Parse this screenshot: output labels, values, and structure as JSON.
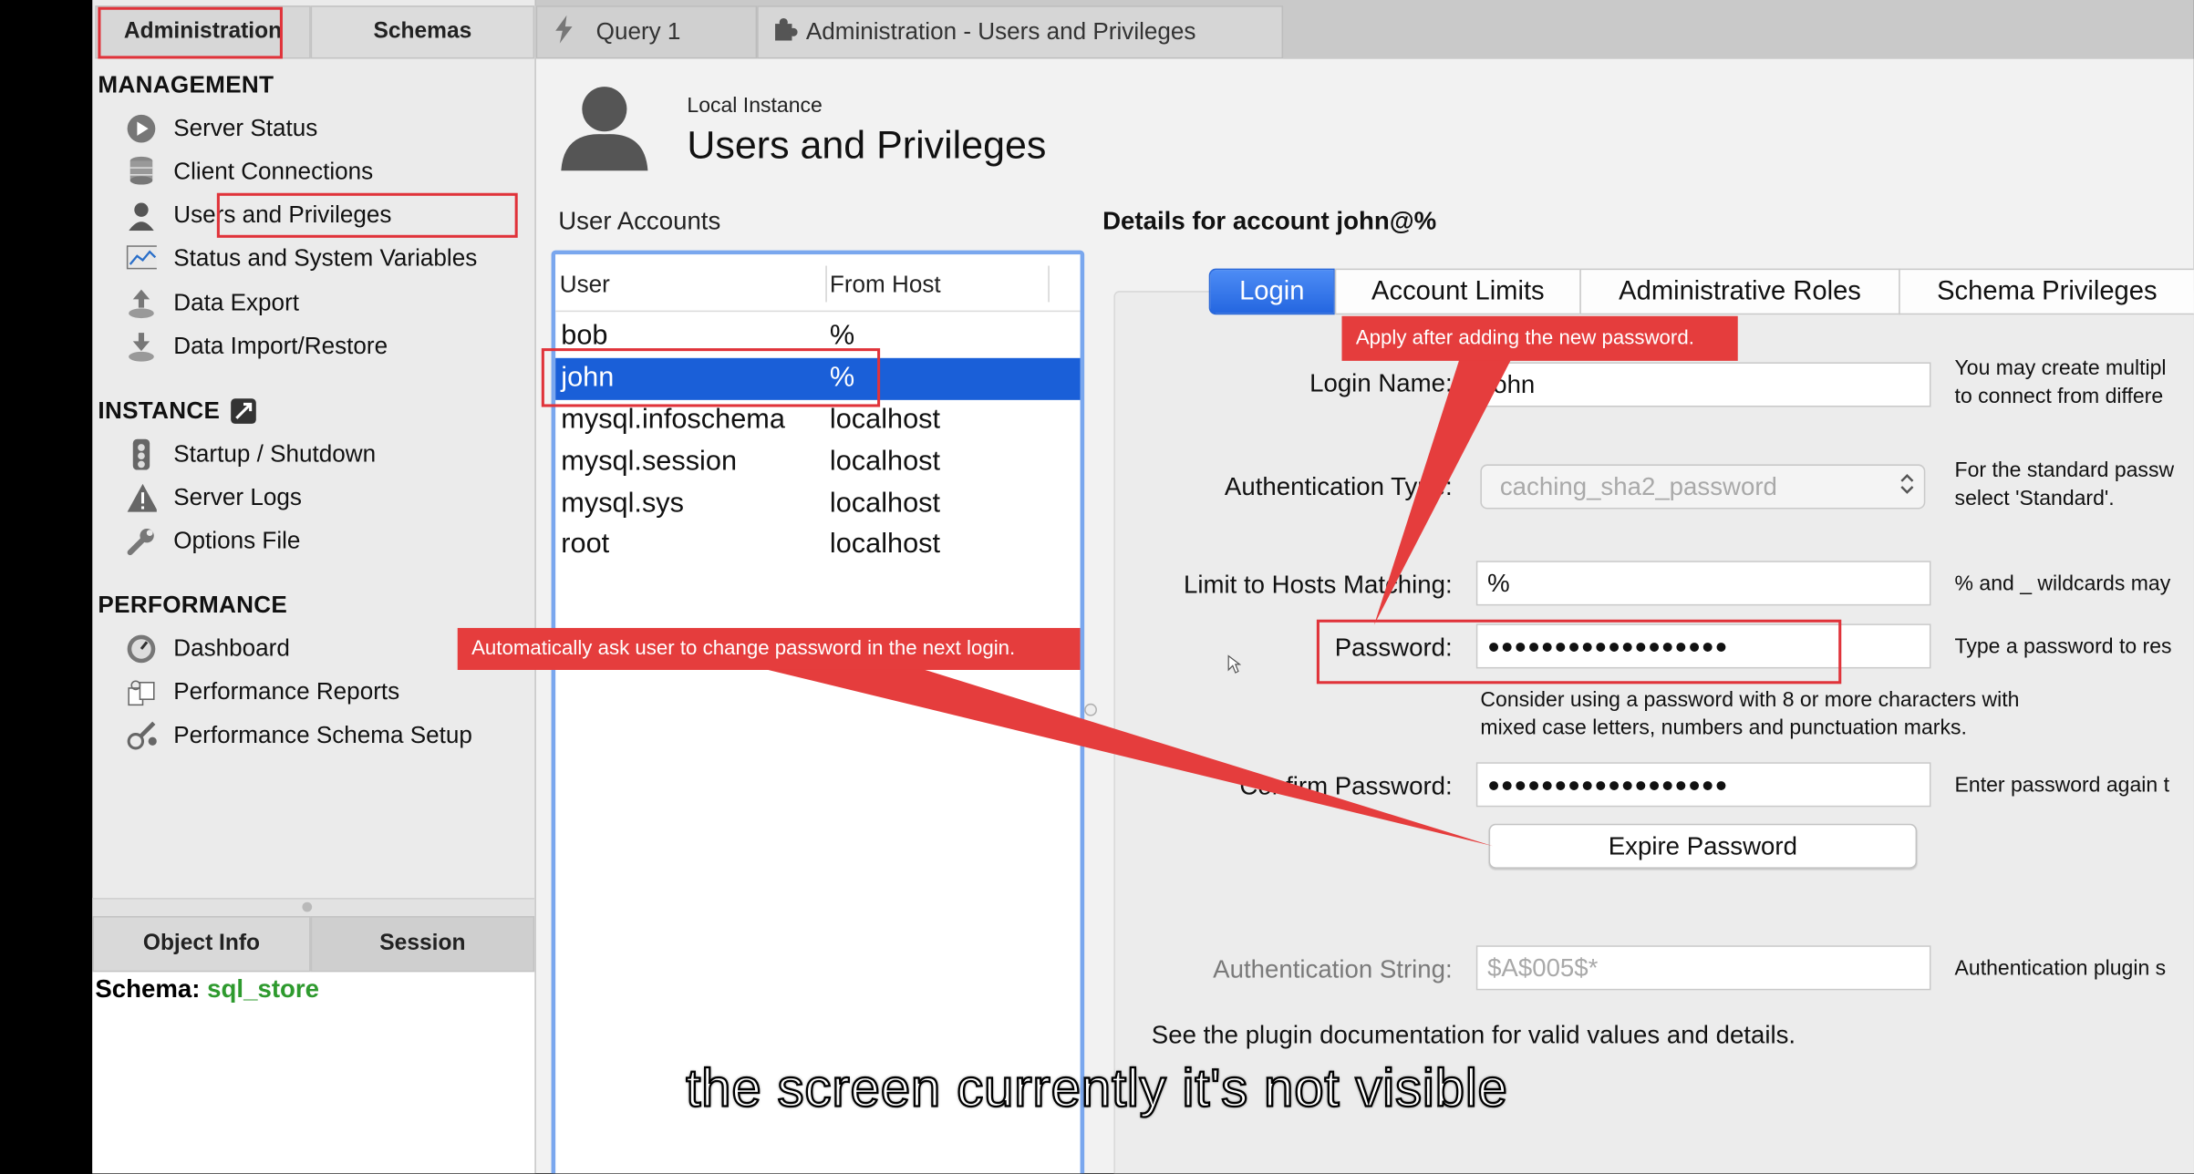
{
  "sidebar": {
    "tabs": [
      "Administration",
      "Schemas"
    ],
    "sections": {
      "management": "MANAGEMENT",
      "instance": "INSTANCE",
      "performance": "PERFORMANCE"
    },
    "management_items": [
      "Server Status",
      "Client Connections",
      "Users and Privileges",
      "Status and System Variables",
      "Data Export",
      "Data Import/Restore"
    ],
    "instance_items": [
      "Startup / Shutdown",
      "Server Logs",
      "Options File"
    ],
    "performance_items": [
      "Dashboard",
      "Performance Reports",
      "Performance Schema Setup"
    ],
    "bottom_tabs": [
      "Object Info",
      "Session"
    ],
    "schema_label": "Schema:",
    "schema_value": "sql_store"
  },
  "editor_tabs": [
    "Query 1",
    "Administration - Users and Privileges"
  ],
  "page": {
    "subtitle": "Local Instance",
    "title": "Users and Privileges"
  },
  "accounts": {
    "label": "User Accounts",
    "columns": [
      "User",
      "From Host"
    ],
    "rows": [
      {
        "user": "bob",
        "host": "%"
      },
      {
        "user": "john",
        "host": "%"
      },
      {
        "user": "mysql.infoschema",
        "host": "localhost"
      },
      {
        "user": "mysql.session",
        "host": "localhost"
      },
      {
        "user": "mysql.sys",
        "host": "localhost"
      },
      {
        "user": "root",
        "host": "localhost"
      }
    ],
    "selected_index": 1
  },
  "details": {
    "heading": "Details for account john@%",
    "tabs": [
      "Login",
      "Account Limits",
      "Administrative Roles",
      "Schema Privileges"
    ],
    "login_name_label": "Login Name:",
    "login_name_value": "john",
    "auth_type_label": "Authentication Type:",
    "auth_type_value": "caching_sha2_password",
    "hosts_label": "Limit to Hosts Matching:",
    "hosts_value": "%",
    "password_label": "Password:",
    "password_value": "●●●●●●●●●●●●●●●●●●",
    "password_hint_1": "Consider using a password with 8 or more characters with",
    "password_hint_2": "mixed case letters, numbers and punctuation marks.",
    "confirm_label": "Confirm Password:",
    "confirm_value": "●●●●●●●●●●●●●●●●●●",
    "expire_button": "Expire Password",
    "auth_string_label": "Authentication String:",
    "auth_string_placeholder": "$A$005$*",
    "plugin_doc": "See the plugin documentation for valid values and details.",
    "help_login_1": "You may create multipl",
    "help_login_2": "to connect from differe",
    "help_auth_1": "For the standard passw",
    "help_auth_2": "select 'Standard'.",
    "help_hosts": "% and _ wildcards may",
    "help_password": "Type a password to res",
    "help_confirm": "Enter password again t",
    "help_auth_string": "Authentication plugin s"
  },
  "callouts": {
    "apply": "Apply after adding the new password.",
    "expire": "Automatically ask user to change password in the next login."
  },
  "caption": "the screen currently it's not visible",
  "colors": {
    "accent": "#2d72e8",
    "selection": "#1a5fd8",
    "annotation_red": "#e53d3d",
    "schema_green": "#2e9a2e"
  }
}
